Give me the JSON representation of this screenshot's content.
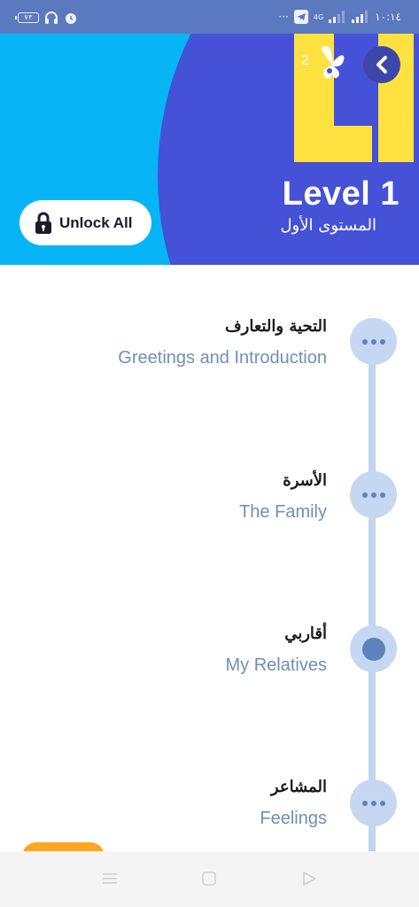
{
  "status_bar": {
    "battery_level": "٧٣",
    "time": "١٠:١٤",
    "network": "4G",
    "icons": [
      "headphones-icon",
      "alarm-icon",
      "telegram-icon",
      "signal-icon"
    ]
  },
  "header": {
    "level_badge": "2",
    "level_title": "Level 1",
    "level_subtitle": "المستوى الأول",
    "unlock_label": "Unlock All",
    "colors": {
      "sky": "#07b5f6",
      "indigo": "#4551d6",
      "yellow": "#ffe23f"
    }
  },
  "lessons": [
    {
      "arabic": "التحية والتعارف",
      "english": "Greetings and Introduction",
      "state": "locked"
    },
    {
      "arabic": "الأسرة",
      "english": "The Family",
      "state": "locked"
    },
    {
      "arabic": "أقاربي",
      "english": "My Relatives",
      "state": "current"
    },
    {
      "arabic": "المشاعر",
      "english": "Feelings",
      "state": "locked"
    }
  ],
  "nav": {
    "icons": [
      "menu-icon",
      "home-square-icon",
      "back-triangle-icon"
    ]
  }
}
